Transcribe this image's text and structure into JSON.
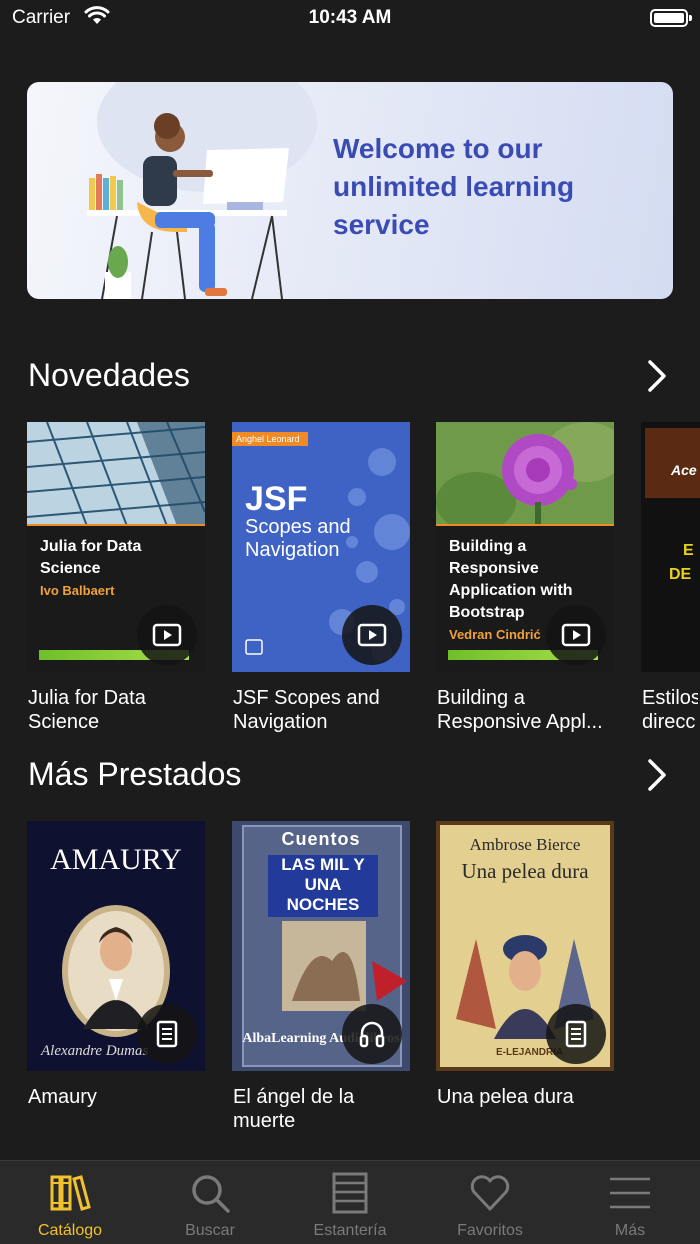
{
  "status_bar": {
    "carrier": "Carrier",
    "time": "10:43 AM"
  },
  "banner": {
    "text": "Welcome to our unlimited learning service"
  },
  "sections": [
    {
      "title": "Novedades",
      "books": [
        {
          "title": "Julia for Data Science",
          "cover_title": "Julia for Data Science",
          "cover_author": "Ivo Balbaert",
          "media": "video"
        },
        {
          "title": "JSF Scopes and Navigation",
          "cover_title_1": "JSF",
          "cover_title_2": "Scopes and Navigation",
          "cover_author": "Anghel Leonard",
          "media": "video"
        },
        {
          "title": "Building a Responsive Appl...",
          "cover_title": "Building a Responsive Application with Bootstrap",
          "cover_author": "Vedran Cindrić",
          "media": "video"
        },
        {
          "title": "Estilos direcc"
        }
      ]
    },
    {
      "title": "Más Prestados",
      "books": [
        {
          "title": "Amaury",
          "cover_title": "AMAURY",
          "cover_author": "Alexandre Dumas",
          "media": "document"
        },
        {
          "title": "El ángel de la muerte",
          "cover_top": "Cuentos",
          "cover_title": "LAS MIL Y UNA NOCHES",
          "cover_footer": "AlbaLearning Audiolibros",
          "media": "audio"
        },
        {
          "title": "Una pelea dura",
          "cover_author": "Ambrose Bierce",
          "cover_title": "Una pelea dura",
          "cover_footer": "E-LEJANDRIA",
          "media": "document"
        }
      ]
    }
  ],
  "tabs": [
    {
      "label": "Catálogo",
      "icon": "books-icon",
      "active": true
    },
    {
      "label": "Buscar",
      "icon": "search-icon",
      "active": false
    },
    {
      "label": "Estantería",
      "icon": "shelf-icon",
      "active": false
    },
    {
      "label": "Favoritos",
      "icon": "heart-icon",
      "active": false
    },
    {
      "label": "Más",
      "icon": "menu-icon",
      "active": false
    }
  ],
  "colors": {
    "background": "#1c1c1c",
    "accent": "#f2c12e",
    "banner_text": "#3b4bb4",
    "tab_inactive": "#7a7a7a"
  }
}
